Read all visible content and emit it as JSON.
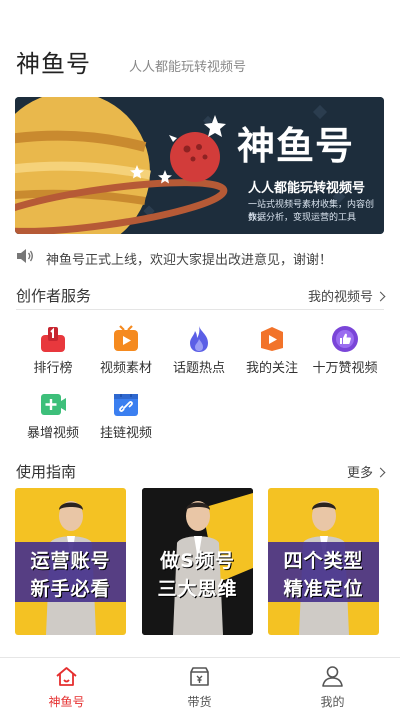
{
  "header": {
    "app_title": "神鱼号",
    "slogan": "人人都能玩转视频号"
  },
  "banner": {
    "title": "神鱼号",
    "subtitle": "人人都能玩转视频号",
    "desc_line1": "一站式视频号素材收集，内容创作，",
    "desc_line2": "数据分析，变现运营的工具"
  },
  "notice": {
    "icon": "speaker-icon",
    "text": "神鱼号正式上线，欢迎大家提出改进意见，谢谢！"
  },
  "creator_services": {
    "title": "创作者服务",
    "link_label": "我的视频号",
    "items": [
      {
        "label": "排行榜",
        "icon": "ranking-icon",
        "color": "#e8383d"
      },
      {
        "label": "视频素材",
        "icon": "video-material-icon",
        "color": "#f58a1f"
      },
      {
        "label": "话题热点",
        "icon": "flame-icon",
        "color": "#5b5fe6"
      },
      {
        "label": "我的关注",
        "icon": "play-follow-icon",
        "color": "#f2732a"
      },
      {
        "label": "十万赞视频",
        "icon": "thumbs-up-icon",
        "color": "#7a45d8"
      },
      {
        "label": "暴增视频",
        "icon": "add-video-icon",
        "color": "#3dbf7a"
      },
      {
        "label": "挂链视频",
        "icon": "link-icon",
        "color": "#3b7ff0"
      }
    ]
  },
  "guide": {
    "title": "使用指南",
    "link_label": "更多",
    "cards": [
      {
        "line1": "运营账号",
        "line2": "新手必看"
      },
      {
        "line1": "做S频号",
        "line2": "三大思维"
      },
      {
        "line1": "四个类型",
        "line2": "精准定位"
      }
    ]
  },
  "tabbar": {
    "tabs": [
      {
        "label": "神鱼号",
        "icon": "home-icon",
        "active": true
      },
      {
        "label": "带货",
        "icon": "shop-icon",
        "active": false
      },
      {
        "label": "我的",
        "icon": "user-icon",
        "active": false
      }
    ],
    "active_color": "#e52e2e"
  }
}
